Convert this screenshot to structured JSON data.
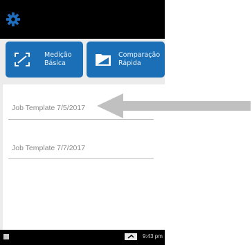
{
  "buttons": [
    {
      "line1": "Medição",
      "line2": "Básica",
      "icon": "measure-icon"
    },
    {
      "line1": "Comparação",
      "line2": "Rápida",
      "icon": "compare-icon"
    }
  ],
  "jobs": [
    {
      "label": "Job Template 7/5/2017"
    },
    {
      "label": "Job Template 7/7/2017"
    }
  ],
  "status": {
    "time": "9:43 pm"
  },
  "colors": {
    "accent": "#1a6fb7",
    "gear": "#1e6fc0",
    "arrow": "#c0c0c0"
  }
}
